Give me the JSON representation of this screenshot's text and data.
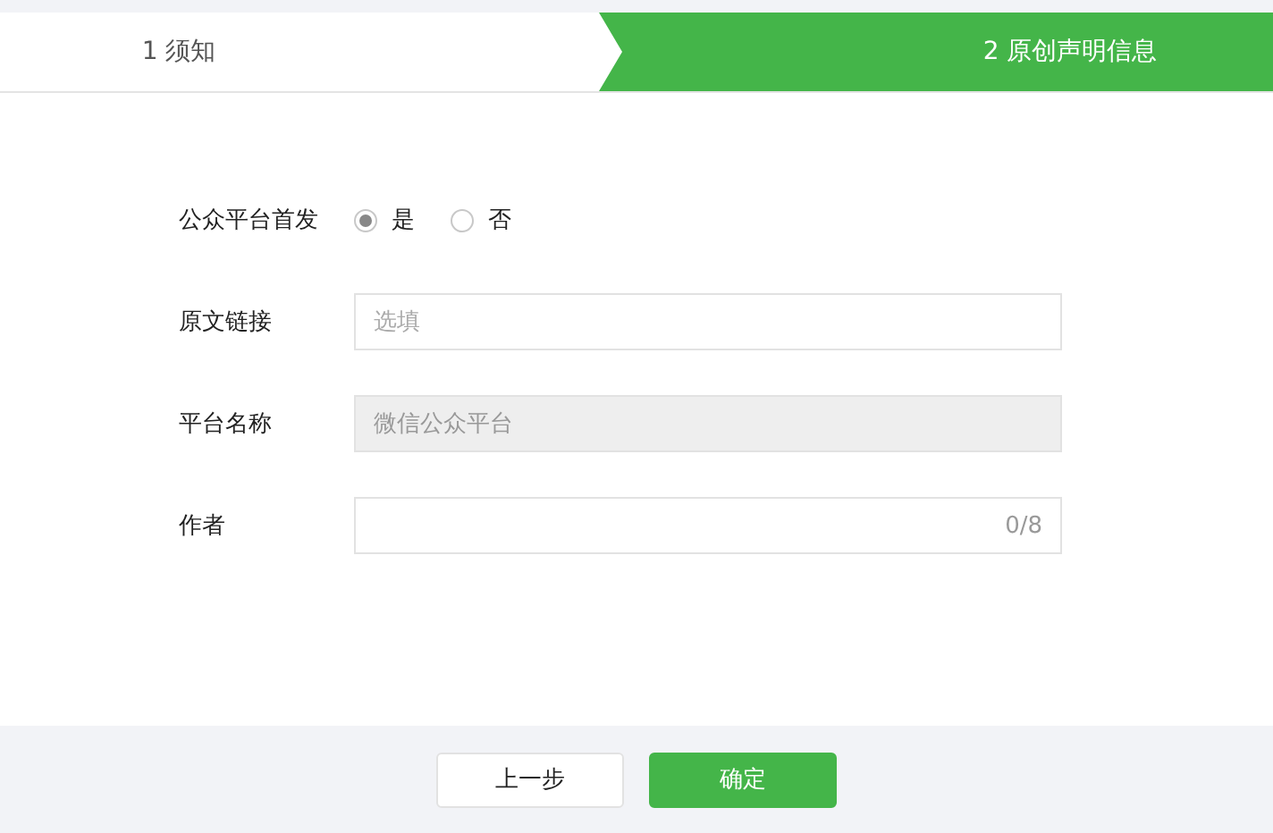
{
  "steps": [
    {
      "label": "1 须知",
      "selected": false
    },
    {
      "label": "2 原创声明信息",
      "selected": true
    }
  ],
  "form": {
    "rows": [
      {
        "kind": "radio",
        "label": "公众平台首发",
        "options": [
          {
            "label": "是",
            "selected": true
          },
          {
            "label": "否",
            "selected": false
          }
        ]
      },
      {
        "kind": "input",
        "label": "原文链接",
        "placeholder": "选填"
      },
      {
        "kind": "disabled",
        "label": "平台名称",
        "value": "微信公众平台"
      },
      {
        "kind": "counter",
        "label": "作者",
        "counter": "0/8"
      }
    ]
  },
  "buttons": [
    {
      "label": "上一步",
      "kind": "secondary"
    },
    {
      "label": "确定",
      "kind": "primary"
    }
  ]
}
